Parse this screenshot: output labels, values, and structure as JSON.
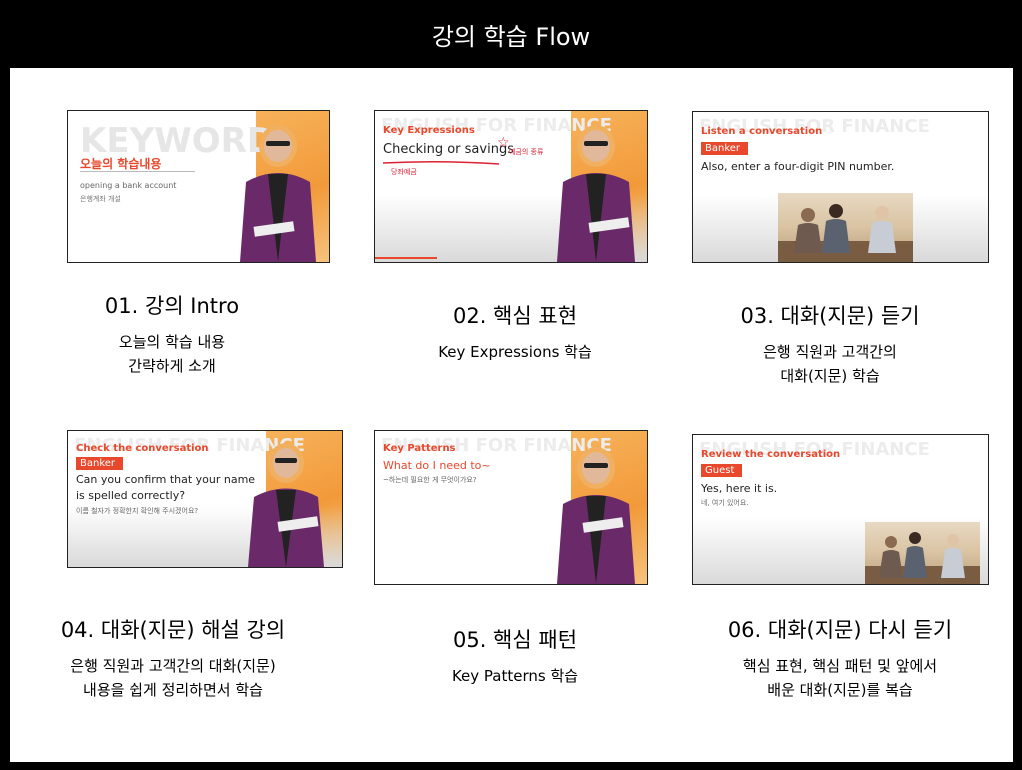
{
  "header": {
    "title": "강의 학습 Flow"
  },
  "colors": {
    "accent": "#e8482c",
    "orange": "#f29a3a",
    "jacket": "#6a2a6a"
  },
  "cards": [
    {
      "bg_word": "KEYWORD",
      "heading": "오늘의 학습내용",
      "line1": "opening a bank account",
      "line2": "은행계좌 개설",
      "caption_title": "01. 강의 Intro",
      "caption_desc1": "오늘의 학습 내용",
      "caption_desc2": "간략하게 소개"
    },
    {
      "bg_word": "ENGLISH FOR FINANCE",
      "section": "Key Expressions",
      "phrase": "Checking or savings",
      "note1": "예금의 종류",
      "note2": "당좌예금",
      "caption_title": "02. 핵심 표현",
      "caption_desc1": "Key Expressions 학습"
    },
    {
      "bg_word": "ENGLISH FOR FINANCE",
      "section": "Listen a conversation",
      "tag": "Banker",
      "line1": "Also, enter a four-digit PIN number.",
      "caption_title": "03. 대화(지문) 듣기",
      "caption_desc1": "은행 직원과 고객간의",
      "caption_desc2": "대화(지문) 학습"
    },
    {
      "bg_word": "ENGLISH FOR FINANCE",
      "section": "Check the conversation",
      "tag": "Banker",
      "line1": "Can you confirm that your name",
      "line2": "is spelled correctly?",
      "line3": "이름 철자가 정확한지 확인해 주시겠어요?",
      "caption_title": "04. 대화(지문) 해설 강의",
      "caption_desc1": "은행 직원과 고객간의 대화(지문)",
      "caption_desc2": "내용을 쉽게 정리하면서 학습"
    },
    {
      "bg_word": "ENGLISH FOR FINANCE",
      "section": "Key Patterns",
      "line1": "What do I need to~",
      "line2": "~하는데 필요한 게 무엇이가요?",
      "caption_title": "05. 핵심 패턴",
      "caption_desc1": "Key Patterns 학습"
    },
    {
      "bg_word": "ENGLISH FOR FINANCE",
      "section": "Review the conversation",
      "tag": "Guest",
      "line1": "Yes, here it is.",
      "line2": "네, 여기 있어요.",
      "caption_title": "06. 대화(지문) 다시 듣기",
      "caption_desc1": "핵심 표현, 핵심 패턴 및 앞에서",
      "caption_desc2": "배운 대화(지문)를 복습"
    }
  ]
}
